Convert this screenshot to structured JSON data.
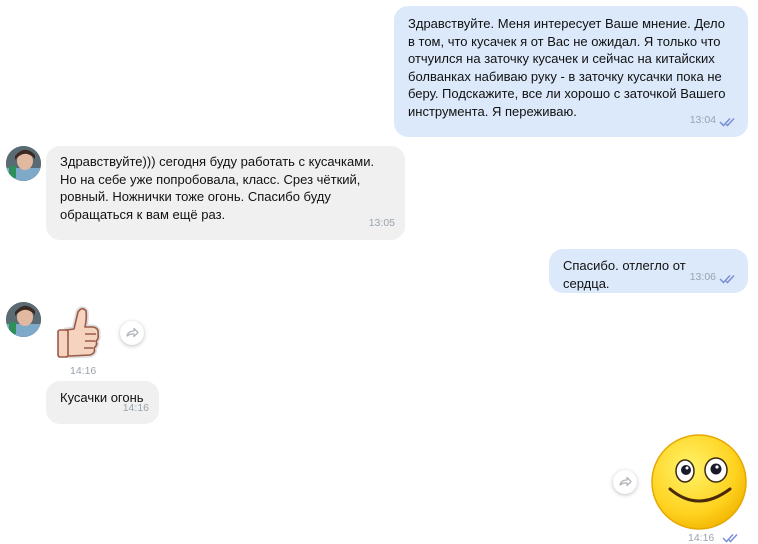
{
  "messages": [
    {
      "text": "Здравствуйте. Меня интересует Ваше мнение. Дело в том, что кусачек я от Вас не ожидал. Я только что отчуился на заточку кусачек и сейчас на китайских болванках набиваю руку - в заточку кусачки пока не беру. Подскажите, все ли хорошо с заточкой Вашего инструмента. Я переживаю.",
      "time": "13:04"
    },
    {
      "text": "Здравствуйте))) сегодня буду работать с кусачками. Но на себе уже попробовала, класс. Срез чёткий, ровный. Ножнички тоже огонь. Спасибо буду обращаться к вам ещё раз.",
      "time": "13:05"
    },
    {
      "text": "Спасибо. отлегло от сердца.",
      "time": "13:06"
    },
    {
      "sticker": "thumbs-up",
      "time": "14:16"
    },
    {
      "text": "Кусачки огонь",
      "time": "14:16"
    },
    {
      "sticker": "smiley-face",
      "time": "14:16"
    }
  ],
  "colors": {
    "outgoing": "#dbe9fb",
    "incoming": "#f0f0f0",
    "read_ticks": "#7b8fd6"
  },
  "icons": [
    "read-ticks-icon",
    "share-icon",
    "avatar"
  ]
}
